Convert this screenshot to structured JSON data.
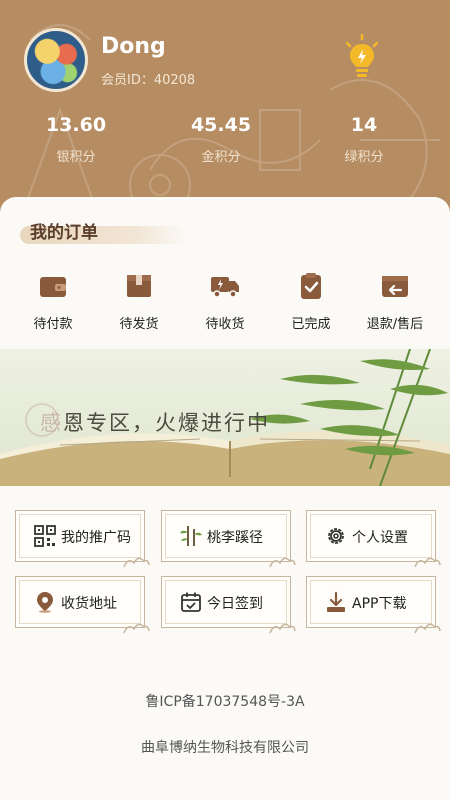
{
  "profile": {
    "username": "Dong",
    "member_id": "会员ID：40208"
  },
  "stats": [
    {
      "value": "13.60",
      "label": "银积分"
    },
    {
      "value": "45.45",
      "label": "金积分"
    },
    {
      "value": "14",
      "label": "绿积分"
    }
  ],
  "orders": {
    "title": "我的订单",
    "items": [
      {
        "label": "待付款",
        "icon": "wallet-icon"
      },
      {
        "label": "待发货",
        "icon": "package-icon"
      },
      {
        "label": "待收货",
        "icon": "truck-icon"
      },
      {
        "label": "已完成",
        "icon": "clipboard-check-icon"
      },
      {
        "label": "退款/售后",
        "icon": "return-icon"
      }
    ]
  },
  "banner": {
    "first_char": "感",
    "rest": "恩专区，火爆进行中"
  },
  "menu": [
    {
      "label": "我的推广码",
      "icon": "qrcode-icon"
    },
    {
      "label": "桃李蹊径",
      "icon": "bamboo-icon"
    },
    {
      "label": "个人设置",
      "icon": "gear-icon"
    },
    {
      "label": "收货地址",
      "icon": "location-pin-icon"
    },
    {
      "label": "今日签到",
      "icon": "calendar-check-icon"
    },
    {
      "label": "APP下载",
      "icon": "download-icon"
    }
  ],
  "footer": {
    "icp": "鲁ICP备17037548号-3A",
    "company": "曲阜博纳生物科技有限公司"
  },
  "colors": {
    "header_bg": "#b68c62",
    "accent_brown": "#8a5a3c",
    "bulb_yellow": "#f3b928"
  }
}
